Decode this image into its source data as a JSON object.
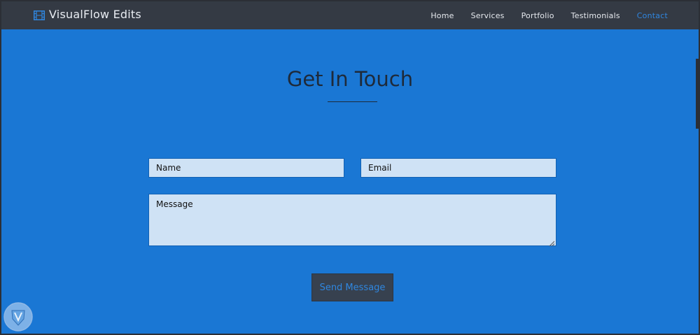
{
  "header": {
    "brand_name": "VisualFlow Edits",
    "brand_icon": "film-icon",
    "nav": [
      {
        "label": "Home",
        "active": false
      },
      {
        "label": "Services",
        "active": false
      },
      {
        "label": "Portfolio",
        "active": false
      },
      {
        "label": "Testimonials",
        "active": false
      },
      {
        "label": "Contact",
        "active": true
      }
    ]
  },
  "contact": {
    "title": "Get In Touch",
    "name_placeholder": "Name",
    "email_placeholder": "Email",
    "message_placeholder": "Message",
    "send_label": "Send Message"
  },
  "colors": {
    "background": "#1a77d4",
    "navbar": "#343a44",
    "accent": "#2f86df",
    "field": "#cfe2f5",
    "button": "#37414f"
  }
}
